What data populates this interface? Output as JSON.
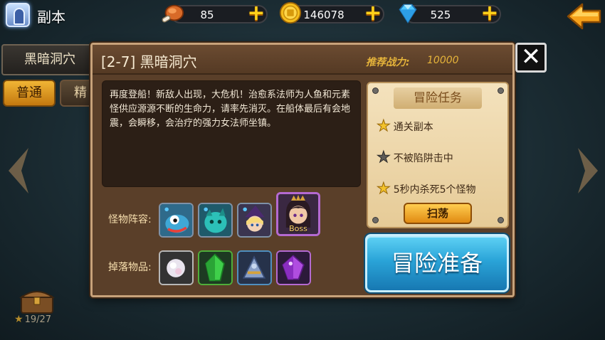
{
  "top_bar": {
    "title": "副本",
    "stamina": "85",
    "gold": "146078",
    "gems": "525"
  },
  "side": {
    "dungeon_tab": "黑暗洞穴",
    "normal_tab": "普通",
    "elite_tab": "精",
    "star_progress": "19/27"
  },
  "dialog": {
    "stage_title": "[2-7] 黑暗洞穴",
    "power_label": "推荐战力:",
    "power_value": "10000",
    "description": "再度登船！新敌人出现，大危机！治愈系法师为人鱼和元素怪供应源源不断的生命力，请率先消灭。在船体最后有会地震，会瞬移，会治疗的强力女法师坐镇。",
    "monster_label": "怪物阵容:",
    "drop_label": "掉落物品:",
    "boss_tag": "Boss",
    "mission": {
      "title": "冒险任务",
      "items": [
        {
          "text": "通关副本",
          "achieved": true
        },
        {
          "text": "不被陷阱击中",
          "achieved": false
        },
        {
          "text": "5秒内杀死5个怪物",
          "achieved": true
        }
      ],
      "sweep_label": "扫荡"
    },
    "ready_label": "冒险准备"
  },
  "colors": {
    "accent_gold": "#f3c22a",
    "ready_blue": "#2aa4d8",
    "dialog_brown": "#5a3f29",
    "power_text": "#e5b33a"
  }
}
